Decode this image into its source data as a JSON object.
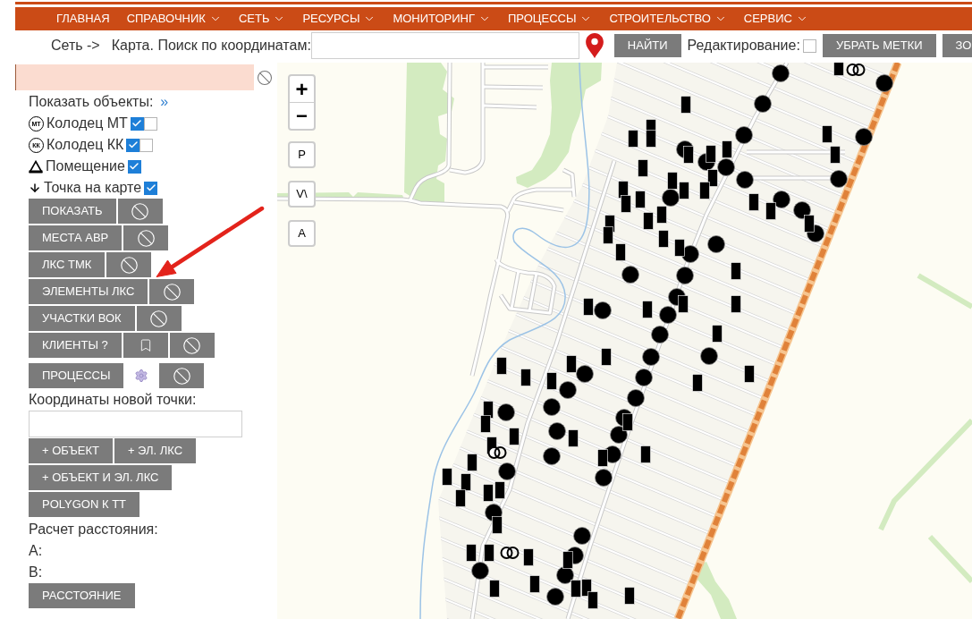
{
  "nav": {
    "items": [
      {
        "label": "ГЛАВНАЯ",
        "dropdown": false
      },
      {
        "label": "СПРАВОЧНИК",
        "dropdown": true
      },
      {
        "label": "СЕТЬ",
        "dropdown": true
      },
      {
        "label": "РЕСУРСЫ",
        "dropdown": true
      },
      {
        "label": "МОНИТОРИНГ",
        "dropdown": true
      },
      {
        "label": "ПРОЦЕССЫ",
        "dropdown": true
      },
      {
        "label": "СТРОИТЕЛЬСТВО",
        "dropdown": true
      },
      {
        "label": "СЕРВИС",
        "dropdown": true
      }
    ]
  },
  "toolbar": {
    "breadcrumb": "Сеть ->",
    "search_label": "Карта. Поиск по координатам:",
    "find_button": "НАЙТИ",
    "edit_label": "Редактирование:",
    "edit_checked": false,
    "buttons": [
      "УБРАТЬ МЕТКИ",
      "ЗО"
    ]
  },
  "sidebar": {
    "show_objects_label": "Показать объекты:",
    "expand_link": "»",
    "layers": [
      {
        "kind": "badge",
        "icon_text": "МТ",
        "label": "Колодец МТ",
        "checked": true,
        "second_checked": false
      },
      {
        "kind": "badge",
        "icon_text": "КК",
        "label": "Колодец КК",
        "checked": true,
        "second_checked": false
      },
      {
        "kind": "triangle",
        "label": "Помещение",
        "checked": true
      },
      {
        "kind": "arrow",
        "label": "Точка на карте",
        "checked": true
      }
    ],
    "button_rows": [
      [
        {
          "kind": "text",
          "label": "ПОКАЗАТЬ"
        },
        {
          "kind": "clear"
        }
      ],
      [
        {
          "kind": "text",
          "label": "МЕСТА АВР"
        },
        {
          "kind": "clear"
        }
      ],
      [
        {
          "kind": "text",
          "label": "ЛКС ТМК"
        },
        {
          "kind": "clear"
        }
      ],
      [
        {
          "kind": "text",
          "label": "ЭЛЕМЕНТЫ ЛКС"
        },
        {
          "kind": "clear"
        }
      ],
      [
        {
          "kind": "text",
          "label": "УЧАСТКИ ВОК"
        },
        {
          "kind": "clear"
        }
      ],
      [
        {
          "kind": "text",
          "label": "КЛИЕНТЫ ?"
        },
        {
          "kind": "bookmark"
        },
        {
          "kind": "clear"
        }
      ],
      [
        {
          "kind": "text",
          "label": "ПРОЦЕССЫ"
        },
        {
          "kind": "gear"
        },
        {
          "kind": "clear"
        }
      ]
    ],
    "coords_label": "Координаты новой точки:",
    "add_button_rows": [
      [
        "+ ОБЪЕКТ",
        "+ ЭЛ. ЛКС"
      ],
      [
        "+ ОБЪЕКТ И ЭЛ. ЛКС"
      ],
      [
        "POLYGON К ТТ"
      ]
    ],
    "distance_label": "Расчет расстояния:",
    "point_labels": [
      "А:",
      "В:"
    ],
    "distance_button": "РАССТОЯНИЕ"
  },
  "map": {
    "zoom_buttons": [
      "+",
      "−"
    ],
    "tool_buttons": [
      "P",
      "V\\",
      "A"
    ]
  }
}
